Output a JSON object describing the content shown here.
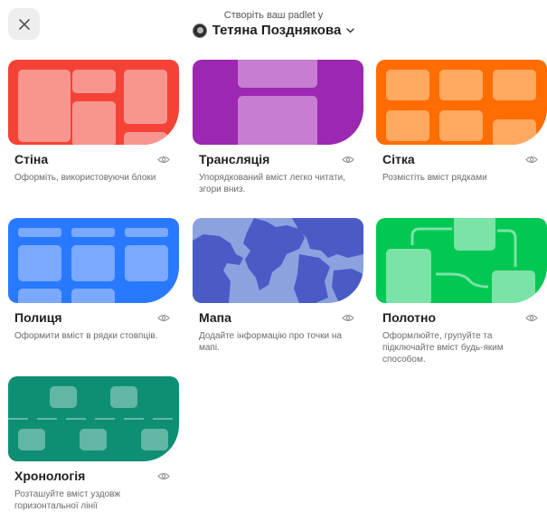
{
  "header": {
    "subtitle": "Створіть ваш padlet у",
    "user_name": "Тетяна Позднякова"
  },
  "icons": {
    "close": "close-icon",
    "chevron": "chevron-down-icon",
    "eye": "eye-icon"
  },
  "colors": {
    "wall": "#f44336",
    "stream": "#9c27b0",
    "grid": "#ff6d00",
    "shelf": "#2979ff",
    "map": "#7e9ad6",
    "canvas": "#00c853",
    "timeline": "#0e8f74"
  },
  "formats": [
    {
      "title": "Стіна",
      "desc": "Оформіть, використовуючи блоки"
    },
    {
      "title": "Трансляція",
      "desc": "Упорядкований вміст легко читати, згори вниз."
    },
    {
      "title": "Сітка",
      "desc": "Розмістіть вміст рядками"
    },
    {
      "title": "Полиця",
      "desc": "Оформити вміст в рядки стовпців."
    },
    {
      "title": "Мапа",
      "desc": "Додайте інформацію про точки на мапі."
    },
    {
      "title": "Полотно",
      "desc": "Оформлюйте, групуйте та підключайте вміст будь-яким способом."
    },
    {
      "title": "Хронологія",
      "desc": "Розташуйте вміст уздовж горизонтальної лінії"
    }
  ]
}
